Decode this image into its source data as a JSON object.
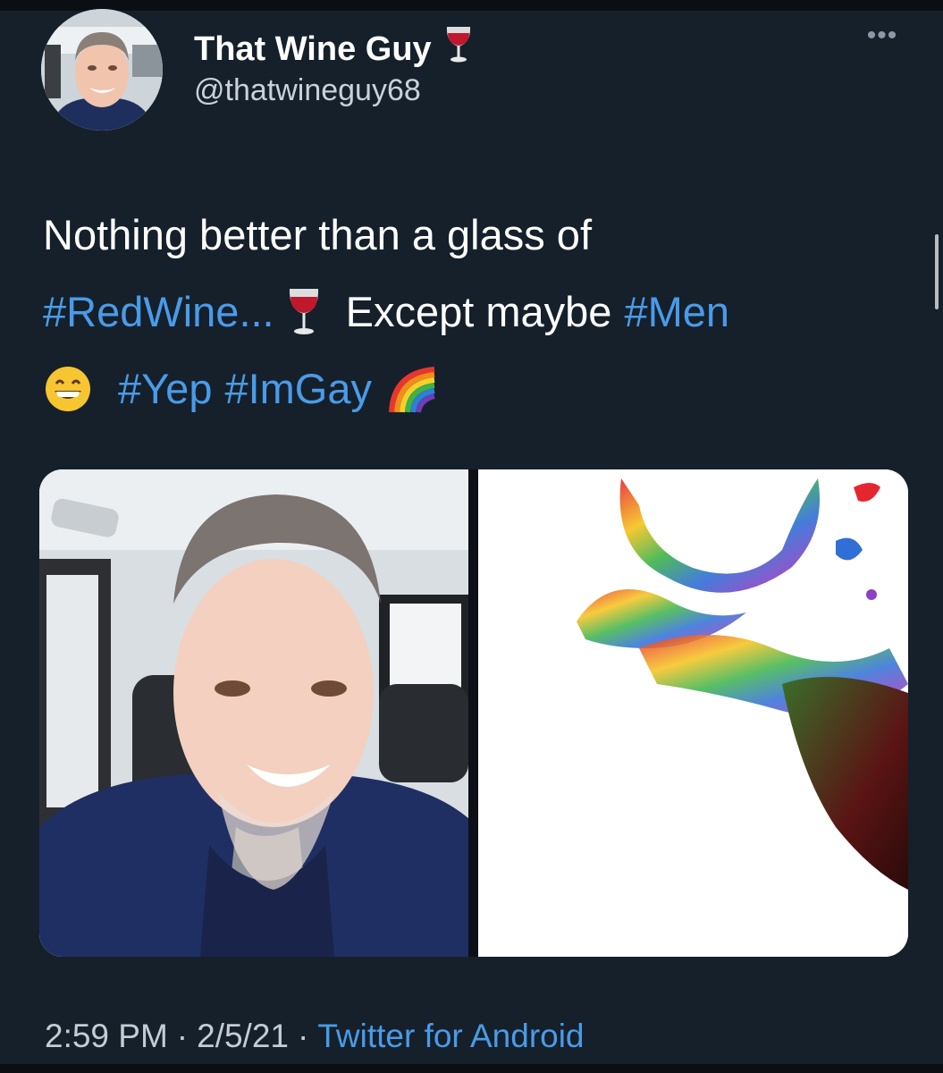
{
  "tweet": {
    "author": {
      "display_name": "That Wine Guy",
      "name_emoji": "wine-glass-icon",
      "handle": "@thatwineguy68"
    },
    "more_label": "•••",
    "text": {
      "line1": "Nothing better than a glass of",
      "hashtag_redwine": "#RedWine...",
      "except_text": "Except maybe",
      "hashtag_men": "#Men",
      "hashtag_yep": "#Yep",
      "hashtag_imgay": "#ImGay"
    },
    "media": [
      {
        "kind": "photo",
        "subject": "selfie of man in car"
      },
      {
        "kind": "photo",
        "subject": "rainbow wine splashing from glass"
      }
    ],
    "timestamp": {
      "time": "2:59 PM",
      "date": "2/5/21",
      "source": "Twitter for Android"
    }
  },
  "colors": {
    "background": "#15202b",
    "link": "#4a9be8",
    "text": "#ffffff",
    "muted": "#c4ccd4"
  }
}
